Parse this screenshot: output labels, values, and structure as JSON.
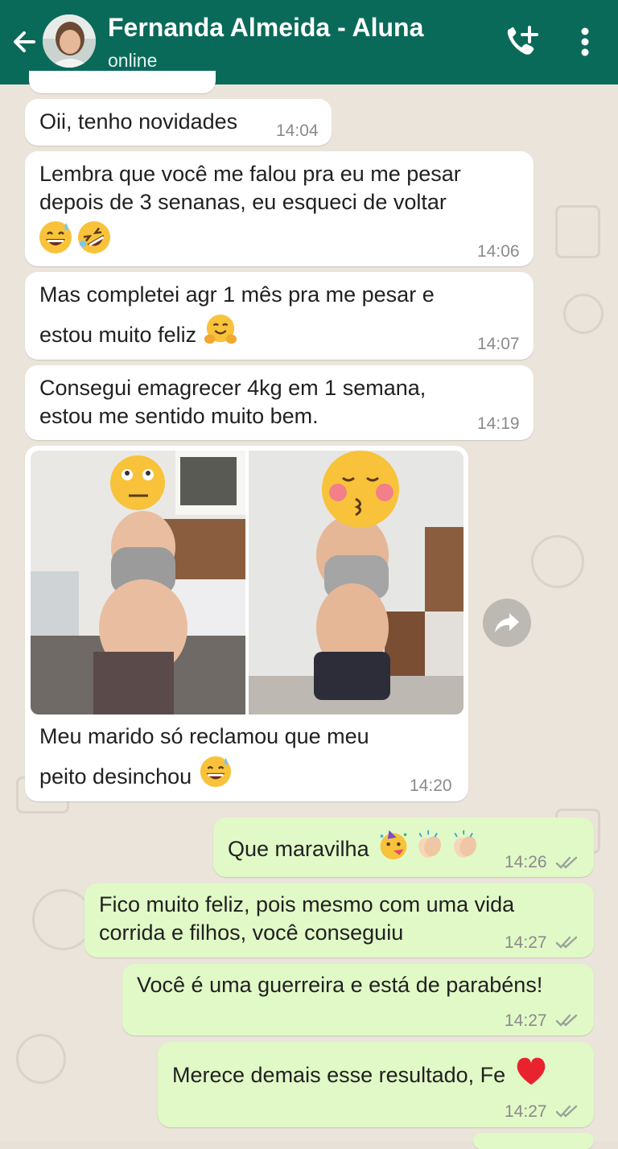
{
  "header": {
    "contact_name": "Fernanda Almeida - Aluna",
    "status": "online"
  },
  "icons": {
    "back": "arrow-left-icon",
    "call": "add-call-icon",
    "menu": "more-vertical-icon",
    "forward": "share-arrow-icon",
    "read": "double-check-icon"
  },
  "colors": {
    "header": "#0a6a5a",
    "incoming_bubble": "#ffffff",
    "outgoing_bubble": "#e1f9c7",
    "wallpaper": "#ebe4da",
    "ticks": "#9aa39a"
  },
  "messages": [
    {
      "direction": "in",
      "text": "Oii, tenho novidades",
      "time": "14:04"
    },
    {
      "direction": "in",
      "line1": "Lembra que você me falou pra eu me pesar",
      "line2": "depois de 3 senanas, eu esqueci de voltar",
      "emojis": [
        "grinning-sweat-emoji",
        "rolling-laughing-emoji"
      ],
      "time": "14:06"
    },
    {
      "direction": "in",
      "line1": "Mas completei agr 1 mês pra me pesar e",
      "line2": "estou muito feliz",
      "emojis": [
        "hugging-face-emoji"
      ],
      "time": "14:07"
    },
    {
      "direction": "in",
      "line1": "Consegui emagrecer 4kg em 1 semana,",
      "line2": "estou me sentido muito bem.",
      "time": "14:19"
    },
    {
      "direction": "in",
      "type": "image",
      "caption_line1": "Meu marido só reclamou que meu",
      "caption_line2": "peito desinchou",
      "emojis": [
        "grinning-sweat-emoji"
      ],
      "time": "14:20"
    },
    {
      "direction": "out",
      "text": "Que maravilha",
      "emojis": [
        "partying-face-emoji",
        "clapping-hands-emoji",
        "clapping-hands-emoji"
      ],
      "time": "14:26"
    },
    {
      "direction": "out",
      "line1": "Fico muito feliz, pois mesmo com uma vida",
      "line2": "corrida e filhos, você conseguiu",
      "time": "14:27"
    },
    {
      "direction": "out",
      "text": "Você é uma guerreira e está de parabéns!",
      "time": "14:27"
    },
    {
      "direction": "out",
      "text": "Merece demais esse resultado, Fe",
      "emojis": [
        "red-heart-emoji"
      ],
      "time": "14:27"
    }
  ]
}
